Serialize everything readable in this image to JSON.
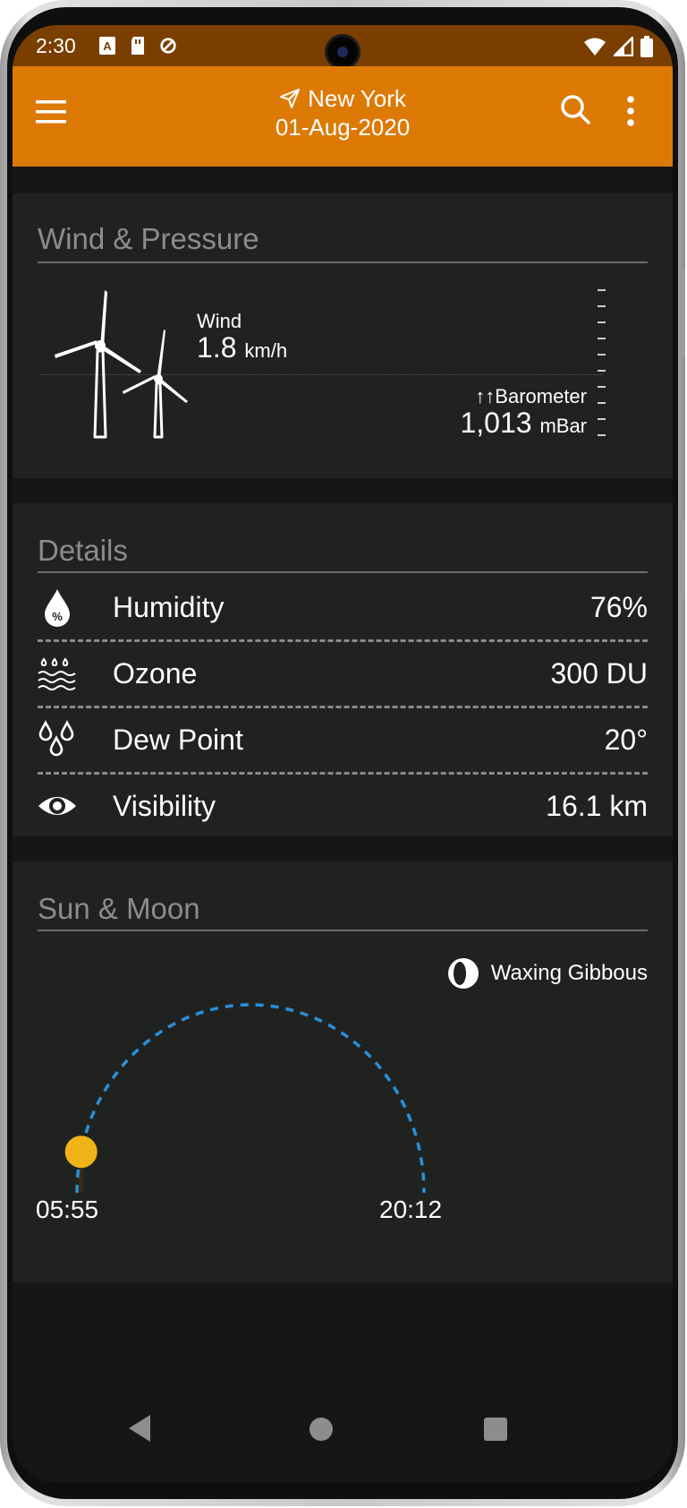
{
  "status_bar": {
    "time": "2:30",
    "icons": [
      "a-notification-icon",
      "sd-card-icon",
      "sync-icon",
      "wifi-icon",
      "signal-icon",
      "battery-icon"
    ]
  },
  "toolbar": {
    "location": "New York",
    "date": "01-Aug-2020",
    "background": "#dd7a05"
  },
  "wind_pressure": {
    "title": "Wind & Pressure",
    "wind_label": "Wind",
    "wind_value": "1.8",
    "wind_unit": "km/h",
    "barometer_label": "↑↑Barometer",
    "barometer_value": "1,013",
    "barometer_unit": "mBar"
  },
  "details": {
    "title": "Details",
    "rows": [
      {
        "icon": "humidity-drop-icon",
        "label": "Humidity",
        "value": "76%"
      },
      {
        "icon": "ozone-waves-icon",
        "label": "Ozone",
        "value": "300 DU"
      },
      {
        "icon": "dew-point-drops-icon",
        "label": "Dew Point",
        "value": "20°"
      },
      {
        "icon": "eye-icon",
        "label": "Visibility",
        "value": "16.1 km"
      }
    ]
  },
  "sun_moon": {
    "title": "Sun & Moon",
    "moon_phase": "Waxing Gibbous",
    "sunrise": "05:55",
    "sunset": "20:12",
    "day_progress": 0.07,
    "arc_color": "#2b8fd8",
    "sun_color": "#f0b418"
  }
}
